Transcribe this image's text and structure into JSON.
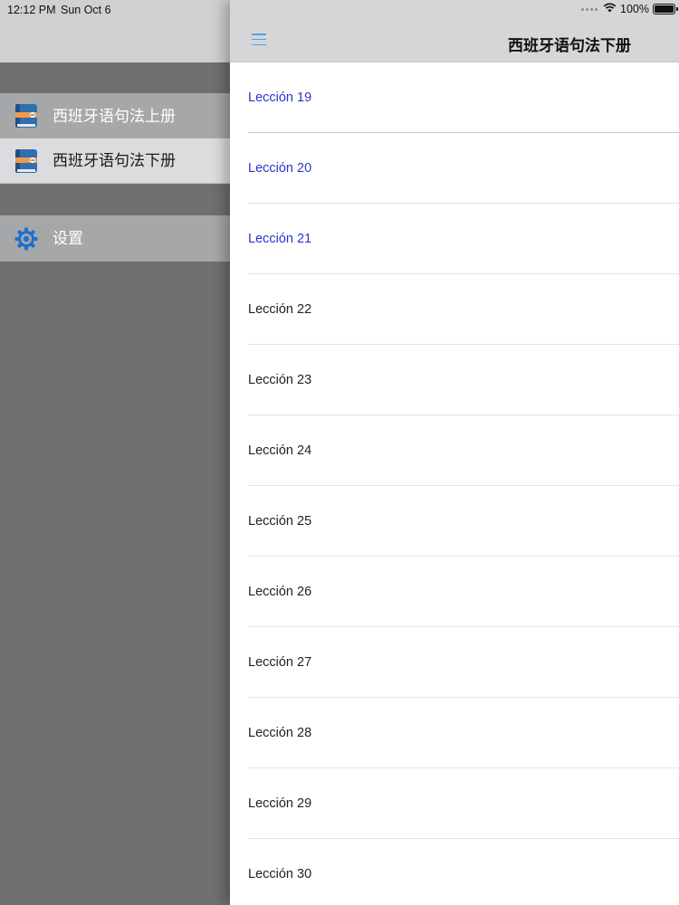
{
  "status_bar": {
    "time": "12:12 PM",
    "date": "Sun Oct 6",
    "battery": "100%"
  },
  "menu": {
    "items": [
      {
        "label": "西班牙语句法上册",
        "icon": "book-icon"
      },
      {
        "label": "西班牙语句法下册",
        "icon": "book-icon",
        "selected": true
      },
      {
        "label": "设置",
        "icon": "gear-icon"
      }
    ]
  },
  "nav": {
    "title": "西班牙语句法下册",
    "menu_icon": "hamburger-menu-icon"
  },
  "lessons": [
    {
      "label": "Lección 19",
      "visited": true
    },
    {
      "label": "Lección 20",
      "visited": true
    },
    {
      "label": "Lección 21",
      "visited": true
    },
    {
      "label": "Lección 22",
      "visited": false
    },
    {
      "label": "Lección 23",
      "visited": false
    },
    {
      "label": "Lección 24",
      "visited": false
    },
    {
      "label": "Lección 25",
      "visited": false
    },
    {
      "label": "Lección 26",
      "visited": false
    },
    {
      "label": "Lección 27",
      "visited": false
    },
    {
      "label": "Lección 28",
      "visited": false
    },
    {
      "label": "Lección 29",
      "visited": false
    },
    {
      "label": "Lección 30",
      "visited": false
    }
  ],
  "colors": {
    "accent": "#4ea3e8",
    "visited_link": "#2a35c9",
    "menu_background": "#6f7072"
  }
}
